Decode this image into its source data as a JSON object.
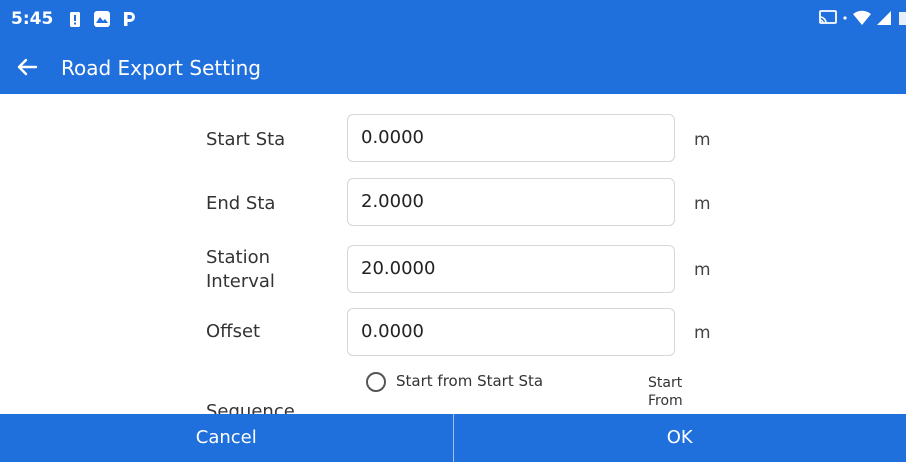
{
  "status_bar": {
    "time": "5:45",
    "left_icons": [
      "battery-alert-icon",
      "photos-icon",
      "parking-icon"
    ],
    "right_icons": [
      "cast-icon",
      "wifi-icon",
      "signal-icon",
      "battery-icon"
    ]
  },
  "toolbar": {
    "back_icon": "arrow-left-icon",
    "title": "Road Export Setting"
  },
  "form": {
    "start_sta": {
      "label": "Start Sta",
      "value": "0.0000",
      "unit": "m"
    },
    "end_sta": {
      "label": "End Sta",
      "value": "2.0000",
      "unit": "m"
    },
    "station_interval": {
      "label_line1": "Station",
      "label_line2": "Interval",
      "value": "20.0000",
      "unit": "m"
    },
    "offset": {
      "label": "Offset",
      "value": "0.0000",
      "unit": "m"
    },
    "sequence": {
      "label": "Sequence",
      "option_1": "Start from Start Sta",
      "option_2_line1": "Start",
      "option_2_line2": "From"
    }
  },
  "footer": {
    "cancel_label": "Cancel",
    "ok_label": "OK"
  },
  "colors": {
    "primary": "#1f6fdc",
    "background": "#ffffff",
    "field_border": "#d6d6d6"
  }
}
